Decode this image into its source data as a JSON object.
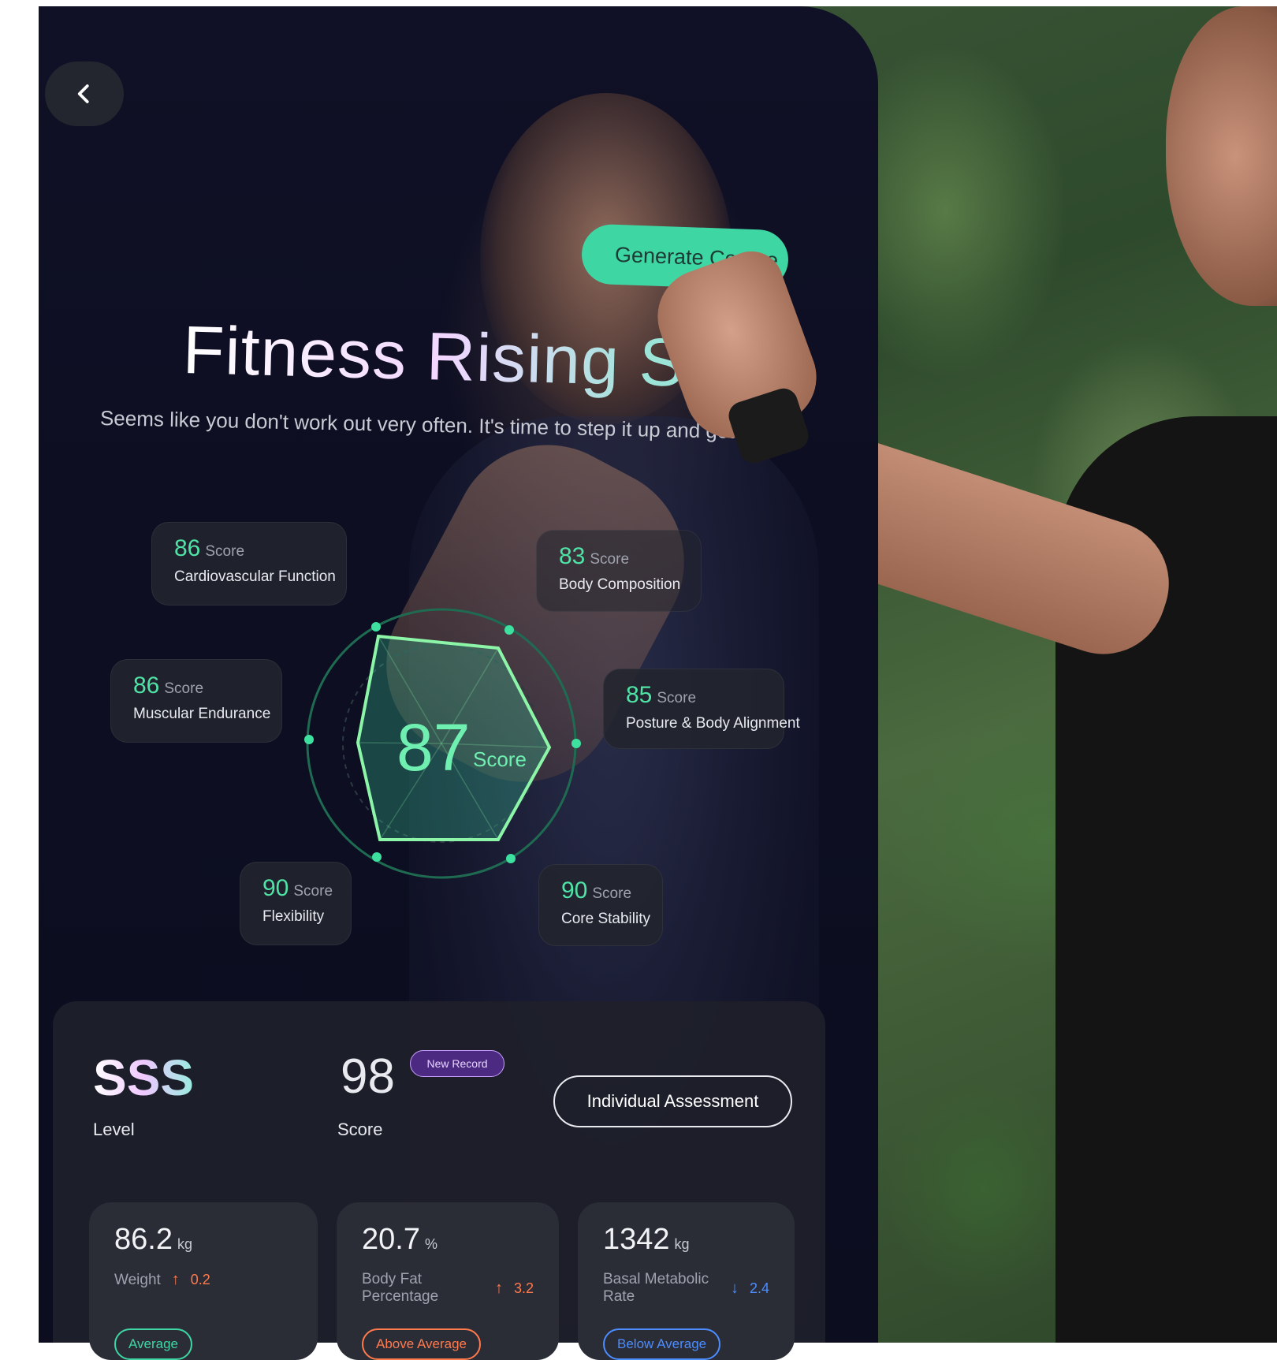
{
  "header": {
    "back_label": ""
  },
  "cta": {
    "label": "Generate Course"
  },
  "hero": {
    "title": "Fitness Rising Star",
    "subtitle": "Seems like you don't work out very often. It's time to step it up and get"
  },
  "overall": {
    "value": "87",
    "label": "Score"
  },
  "scores": [
    {
      "value": "86",
      "unit": "Score",
      "name": "Cardiovascular Function"
    },
    {
      "value": "83",
      "unit": "Score",
      "name": "Body Composition"
    },
    {
      "value": "86",
      "unit": "Score",
      "name": "Muscular Endurance"
    },
    {
      "value": "85",
      "unit": "Score",
      "name": "Posture & Body Alignment"
    },
    {
      "value": "90",
      "unit": "Score",
      "name": "Flexibility"
    },
    {
      "value": "90",
      "unit": "Score",
      "name": "Core Stability"
    }
  ],
  "summary": {
    "level_value": "SSS",
    "level_label": "Level",
    "score_value": "98",
    "score_label": "Score",
    "badge": "New Record",
    "assessment_button": "Individual Assessment"
  },
  "stats": [
    {
      "value": "86.2",
      "unit": "kg",
      "label": "Weight",
      "delta": "0.2",
      "direction": "up",
      "status": "Average",
      "status_color": "#3ed7a4"
    },
    {
      "value": "20.7",
      "unit": "%",
      "label": "Body Fat Percentage",
      "delta": "3.2",
      "direction": "up",
      "status": "Above Average",
      "status_color": "#ff7a4d"
    },
    {
      "value": "1342",
      "unit": "kg",
      "label": "Basal Metabolic Rate",
      "delta": "2.4",
      "direction": "down",
      "status": "Below Average",
      "status_color": "#4d8dff"
    }
  ],
  "colors": {
    "accent_green": "#4fe3a6",
    "up": "#ff7a4d",
    "down": "#4d8dff"
  },
  "icons": {
    "back": "chevron-left-icon",
    "up": "arrow-up-icon",
    "down": "arrow-down-icon"
  }
}
